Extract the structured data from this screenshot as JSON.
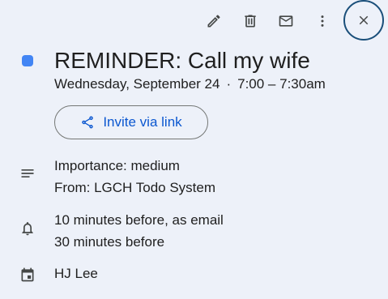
{
  "toolbar": {
    "icons": [
      "pencil-icon",
      "trash-icon",
      "mail-icon",
      "more-vert-icon",
      "close-icon"
    ]
  },
  "event": {
    "title": "REMINDER: Call my wife",
    "date": "Wednesday, September 24",
    "separator": "·",
    "time": "7:00 – 7:30am",
    "color": "#4285f4"
  },
  "invite": {
    "label": "Invite via link"
  },
  "description": {
    "line1": "Importance: medium",
    "line2": "From: LGCH Todo System"
  },
  "notifications": {
    "line1": "10 minutes before, as email",
    "line2": "30 minutes before"
  },
  "calendar": {
    "owner": "HJ Lee"
  },
  "colors": {
    "background": "#edf1f9",
    "accent": "#0b57d0",
    "close_ring": "#1a4f7a"
  }
}
